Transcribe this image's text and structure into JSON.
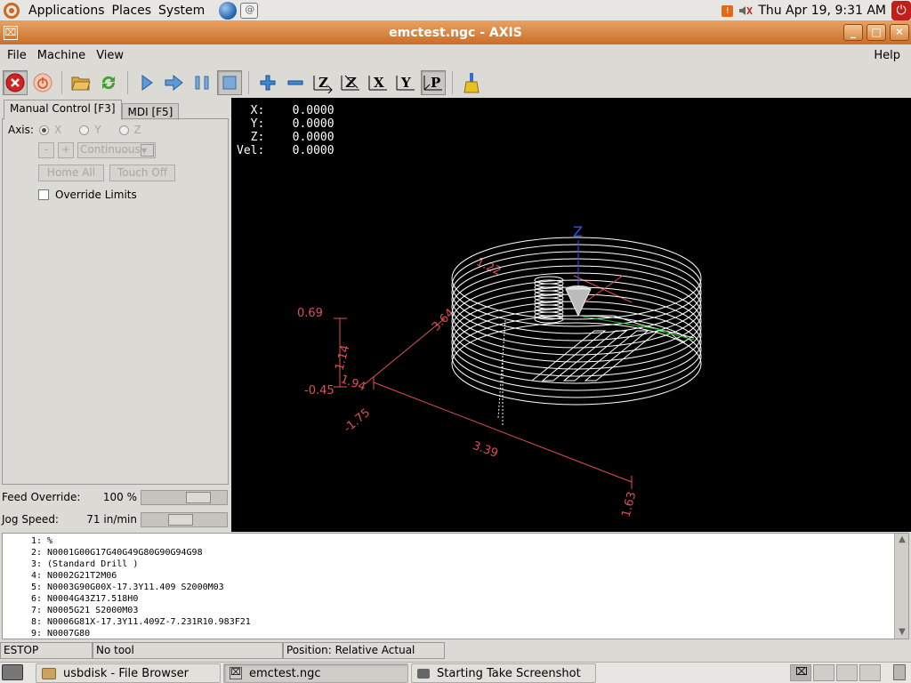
{
  "top_panel": {
    "menus": [
      "Applications",
      "Places",
      "System"
    ],
    "clock": "Thu Apr 19,  9:31 AM"
  },
  "window": {
    "title": "emctest.ngc - AXIS",
    "controls": [
      "minimize",
      "maximize",
      "close"
    ]
  },
  "menubar": {
    "items": [
      "File",
      "Machine",
      "View"
    ],
    "help": "Help"
  },
  "toolbar": {
    "buttons": [
      "estop",
      "machine-power",
      "open-file",
      "reload",
      "run",
      "step",
      "pause",
      "stop",
      "zoom-in",
      "zoom-out",
      "view-z",
      "view-z2",
      "view-x",
      "view-y",
      "view-p",
      "clear-plot"
    ],
    "labels": {
      "z": "Z",
      "z2": "Z",
      "x": "X",
      "y": "Y",
      "p": "P"
    }
  },
  "tabs": {
    "manual": "Manual Control [F3]",
    "mdi": "MDI [F5]"
  },
  "manual_control": {
    "axis_label": "Axis:",
    "axes": [
      "X",
      "Y",
      "Z"
    ],
    "selected_axis": "X",
    "jog_minus": "-",
    "jog_plus": "+",
    "jog_mode": "Continuous",
    "home_all": "Home All",
    "touch_off": "Touch Off",
    "override_limits": "Override Limits"
  },
  "feed_override": {
    "label": "Feed Override:",
    "value": "100 %",
    "fraction": 0.75
  },
  "jog_speed": {
    "label": "Jog Speed:",
    "value": "71 in/min",
    "fraction": 0.45
  },
  "dro": {
    "text": "  X:    0.0000\n  Y:    0.0000\n  Z:    0.0000\nVel:    0.0000"
  },
  "preview": {
    "axis_label": "Z",
    "dimensions": [
      "0.69",
      "1.14",
      "-0.45",
      "3.64",
      "1.94",
      "-1.75",
      "3.39",
      "1.63",
      "1.22"
    ],
    "colors": {
      "background": "#000000",
      "path": "#ffffff",
      "extents": "#e05050",
      "z_axis": "#3050ff",
      "rapid": "#20c020"
    }
  },
  "gcode": {
    "lines": [
      {
        "num": "1:",
        "code": "%"
      },
      {
        "num": "2:",
        "code": "N0001G00G17G40G49G80G90G94G98"
      },
      {
        "num": "3:",
        "code": "(Standard Drill )"
      },
      {
        "num": "4:",
        "code": "N0002G21T2M06"
      },
      {
        "num": "5:",
        "code": "N0003G90G00X-17.3Y11.409 S2000M03"
      },
      {
        "num": "6:",
        "code": "N0004G43Z17.518H0"
      },
      {
        "num": "7:",
        "code": "N0005G21 S2000M03"
      },
      {
        "num": "8:",
        "code": "N0006G81X-17.3Y11.409Z-7.231R10.983F21"
      },
      {
        "num": "9:",
        "code": "N0007G80"
      }
    ]
  },
  "status": {
    "state": "ESTOP",
    "tool": "No tool",
    "position": "Position: Relative Actual"
  },
  "taskbar": {
    "tasks": [
      "usbdisk - File Browser",
      "emctest.ngc",
      "Starting Take Screenshot"
    ]
  }
}
